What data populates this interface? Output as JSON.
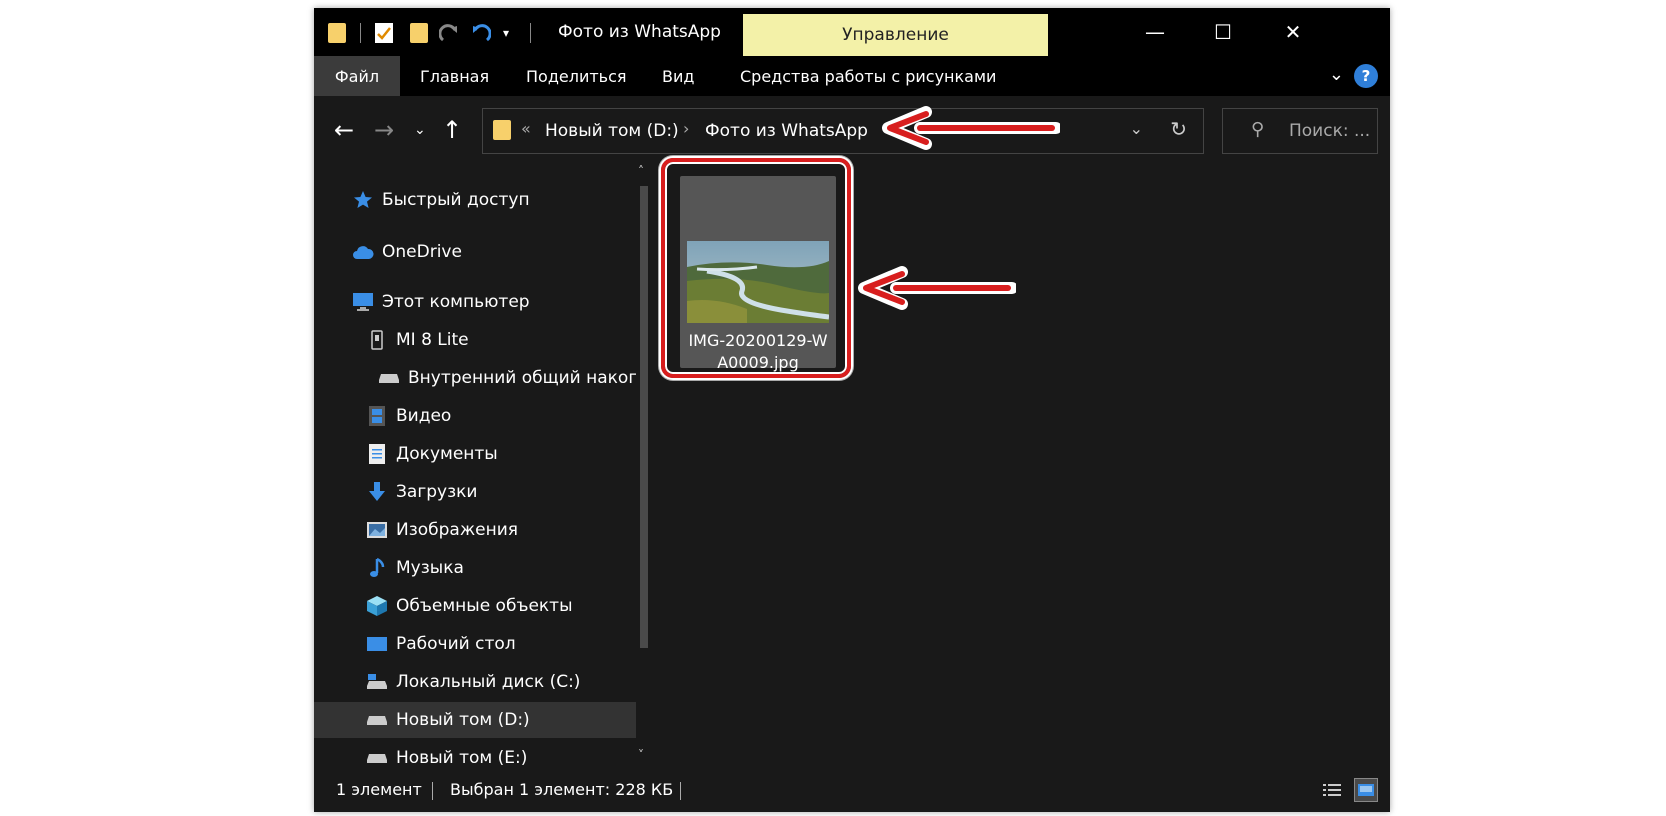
{
  "window": {
    "title": "Фото из WhatsApp",
    "manage_tab": "Управление",
    "controls": {
      "minimize": "—",
      "maximize": "☐",
      "close": "✕"
    }
  },
  "ribbon": {
    "tabs": [
      "Файл",
      "Главная",
      "Поделиться",
      "Вид",
      "Средства работы с рисунками"
    ],
    "help": "?"
  },
  "address": {
    "overflow": "«",
    "crumbs": [
      "Новый том (D:)",
      "Фото из WhatsApp"
    ],
    "separator": "›"
  },
  "search": {
    "placeholder": "Поиск: ..."
  },
  "sidebar": {
    "items": [
      {
        "label": "Быстрый доступ",
        "icon": "star-icon"
      },
      {
        "label": "OneDrive",
        "icon": "cloud-icon"
      },
      {
        "label": "Этот компьютер",
        "icon": "computer-icon"
      },
      {
        "label": "MI 8 Lite",
        "icon": "phone-icon"
      },
      {
        "label": "Внутренний общий накопитель",
        "icon": "drive-icon"
      },
      {
        "label": "Видео",
        "icon": "video-icon"
      },
      {
        "label": "Документы",
        "icon": "document-icon"
      },
      {
        "label": "Загрузки",
        "icon": "download-icon"
      },
      {
        "label": "Изображения",
        "icon": "pictures-icon"
      },
      {
        "label": "Музыка",
        "icon": "music-icon"
      },
      {
        "label": "Объемные объекты",
        "icon": "cube-icon"
      },
      {
        "label": "Рабочий стол",
        "icon": "desktop-icon"
      },
      {
        "label": "Локальный диск (C:)",
        "icon": "drive-icon"
      },
      {
        "label": "Новый том (D:)",
        "icon": "drive-icon",
        "selected": true
      },
      {
        "label": "Новый том (E:)",
        "icon": "drive-icon"
      }
    ]
  },
  "files": [
    {
      "name_line1": "IMG-20200129-W",
      "name_line2": "A0009.jpg"
    }
  ],
  "status": {
    "count": "1 элемент",
    "selected": "Выбран 1 элемент: 228 КБ"
  },
  "colors": {
    "accent_yellow": "#f3f1a8",
    "annotation_red": "#d81e1e",
    "folder": "#f7d06b",
    "background": "#191919"
  }
}
